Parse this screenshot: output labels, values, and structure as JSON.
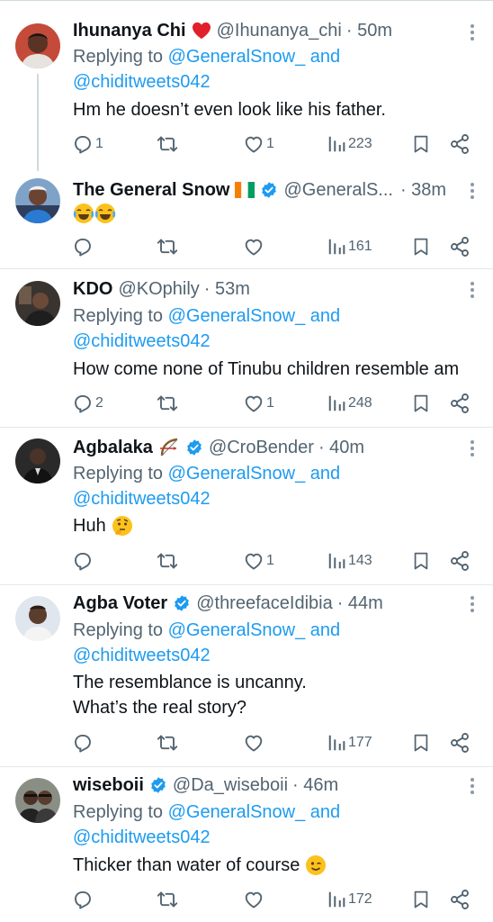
{
  "tweets": [
    {
      "name": "Ihunanya Chi",
      "name_emoji": "red-heart-icon",
      "handle": "@Ihunanya_chi",
      "time": "· 50m",
      "replying_prefix": "Replying to ",
      "replying_to_1": "@GeneralSnow_ and",
      "replying_to_2": "@chiditweets042",
      "text_lines": [
        "Hm he doesn’t even look like his father."
      ],
      "replies": "1",
      "retweets": "",
      "likes": "1",
      "views": "223"
    },
    {
      "name": "The General Snow",
      "name_emoji": "ivory-coast-flag-icon",
      "verified": true,
      "handle": "@GeneralS...",
      "time": "· 38m",
      "text_emoji": "face-with-tears-of-joy-icon x2",
      "replies": "",
      "retweets": "",
      "likes": "",
      "views": "161"
    },
    {
      "name": "KDO",
      "handle": "@KOphily",
      "time": "· 53m",
      "replying_prefix": "Replying to ",
      "replying_to_1": "@GeneralSnow_ and",
      "replying_to_2": "@chiditweets042",
      "text_lines": [
        "How come none of Tinubu children resemble am"
      ],
      "replies": "2",
      "retweets": "",
      "likes": "1",
      "views": "248"
    },
    {
      "name": "Agbalaka",
      "name_emoji": "bow-and-arrow-icon",
      "verified": true,
      "handle": "@CroBender",
      "time": "· 40m",
      "replying_prefix": "Replying to ",
      "replying_to_1": "@GeneralSnow_ and",
      "replying_to_2": "@chiditweets042",
      "text_lines": [
        "Huh"
      ],
      "text_emoji": "thinking-face-icon",
      "replies": "",
      "retweets": "",
      "likes": "1",
      "views": "143"
    },
    {
      "name": "Agba Voter",
      "verified": true,
      "handle": "@threefaceIdibia",
      "time": "· 44m",
      "replying_prefix": "Replying to ",
      "replying_to_1": "@GeneralSnow_ and",
      "replying_to_2": "@chiditweets042",
      "text_lines": [
        "The resemblance is uncanny.",
        "What’s the real story?"
      ],
      "replies": "",
      "retweets": "",
      "likes": "",
      "views": "177"
    },
    {
      "name": "wiseboii",
      "verified": true,
      "handle": "@Da_wiseboii",
      "time": "· 46m",
      "replying_prefix": "Replying to ",
      "replying_to_1": "@GeneralSnow_ and",
      "replying_to_2": "@chiditweets042",
      "text_lines": [
        "Thicker than water of course"
      ],
      "text_emoji": "winking-face-icon",
      "replies": "",
      "retweets": "",
      "likes": "",
      "views": "172"
    }
  ],
  "colors": {
    "text": "#0f1419",
    "secondary": "#536471",
    "link": "#1d9bf0",
    "verified": "#1d9bf0",
    "divider": "#e1e8ed"
  }
}
